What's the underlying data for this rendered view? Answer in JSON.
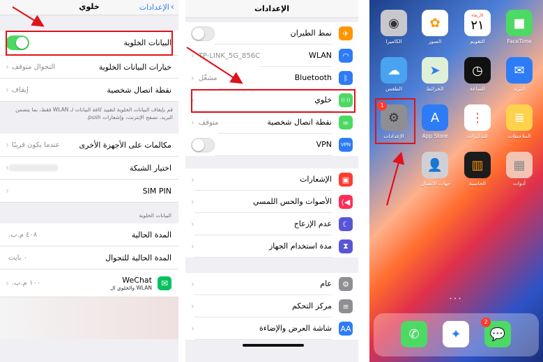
{
  "cellular": {
    "title": "خلوي",
    "back_label": "الإعدادات",
    "cellular_data": {
      "label": "البيانات الخلوية",
      "on": true
    },
    "data_options": {
      "label": "خيارات البيانات الخلوية",
      "value": "التجوال متوقف"
    },
    "hotspot": {
      "label": "نقطة اتصال شخصية",
      "value": "إيقاف"
    },
    "note": "قم بإيقاف البيانات الخلوية لتقييد كافة البيانات لـ WLAN فقط، بما يتضمن البريد، تصفح الإنترنت، وإشعارات push.",
    "other_devices": {
      "label": "مكالمات على الأجهزة الأخرى",
      "value": "عندما يكون قريبًا"
    },
    "network_selection": {
      "label": "اختيار الشبكة"
    },
    "sim_pin": {
      "label": "SIM PIN"
    },
    "section_header": "البيانات الخلوية",
    "current_period": {
      "label": "المدة الحالية",
      "value": "٤٠٨ م.ب."
    },
    "current_roaming": {
      "label": "المدة الحالية للتجوال",
      "value": "٠ بايت"
    },
    "wechat": {
      "label": "WeChat",
      "sublabel": "WLAN والخلوي ال",
      "value": "١٠٠ م.ب."
    }
  },
  "settings": {
    "title": "الإعدادات",
    "rows": [
      {
        "label": "نمط الطيران",
        "icon": "airplane-icon",
        "color": "#ff9500",
        "glyph": "✈",
        "toggle": true
      },
      {
        "label": "WLAN",
        "icon": "wifi-icon",
        "color": "#2d7cf6",
        "glyph": "◠",
        "value": "TP-LINK_5G_856C"
      },
      {
        "label": "Bluetooth",
        "icon": "bluetooth-icon",
        "color": "#2d7cf6",
        "glyph": "ᛒ",
        "value": "مشغّل"
      },
      {
        "label": "خلوي",
        "icon": "cellular-icon",
        "color": "#4cd964",
        "glyph": "((·))"
      },
      {
        "label": "نقطة اتصال شخصية",
        "icon": "hotspot-icon",
        "color": "#4cd964",
        "glyph": "∞",
        "value": "متوقف"
      },
      {
        "label": "VPN",
        "icon": "vpn-icon",
        "color": "#2d7cf6",
        "glyph": "VPN",
        "toggle": true
      }
    ],
    "rows2": [
      {
        "label": "الإشعارات",
        "icon": "notifications-icon",
        "color": "#ff3b30",
        "glyph": "▣"
      },
      {
        "label": "الأصوات والحس اللمسي",
        "icon": "sounds-icon",
        "color": "#ff2d55",
        "glyph": "◀)"
      },
      {
        "label": "عدم الإزعاج",
        "icon": "moon-icon",
        "color": "#5856d6",
        "glyph": "☾"
      },
      {
        "label": "مدة استخدام الجهاز",
        "icon": "hourglass-icon",
        "color": "#5856d6",
        "glyph": "⧗"
      }
    ],
    "rows3": [
      {
        "label": "عام",
        "icon": "gear-icon",
        "color": "#8e8e93",
        "glyph": "⚙"
      },
      {
        "label": "مركز التحكم",
        "icon": "control-center-icon",
        "color": "#8e8e93",
        "glyph": "≡"
      },
      {
        "label": "شاشة العرض والإضاءة",
        "icon": "display-icon",
        "color": "#2d7cf6",
        "glyph": "AA"
      }
    ]
  },
  "home": {
    "apps": [
      {
        "name": "FaceTime",
        "icon": "facetime-icon",
        "bg": "#4cd964",
        "glyph": "■",
        "fg": "#fff"
      },
      {
        "name": "التقويم",
        "icon": "calendar-icon",
        "bg": "#ffffff",
        "glyph": "٢١",
        "fg": "#000",
        "top": "الأربعاء"
      },
      {
        "name": "الصور",
        "icon": "photos-icon",
        "bg": "#ffffff",
        "glyph": "✿",
        "fg": "#ff9500"
      },
      {
        "name": "الكاميرا",
        "icon": "camera-icon",
        "bg": "#c7c7cc",
        "glyph": "◉",
        "fg": "#333"
      },
      {
        "name": "البريد",
        "icon": "mail-icon",
        "bg": "#2d7cf6",
        "glyph": "✉",
        "fg": "#fff"
      },
      {
        "name": "الساعة",
        "icon": "clock-icon",
        "bg": "#111111",
        "glyph": "◷",
        "fg": "#fff"
      },
      {
        "name": "الخرائط",
        "icon": "maps-icon",
        "bg": "#dff0d8",
        "glyph": "➤",
        "fg": "#2d7cf6"
      },
      {
        "name": "الطقس",
        "icon": "weather-icon",
        "bg": "#4aa3f0",
        "glyph": "☁",
        "fg": "#fff"
      },
      {
        "name": "الملاحظات",
        "icon": "notes-icon",
        "bg": "#ffd24d",
        "glyph": "≣",
        "fg": "#fff"
      },
      {
        "name": "التذكيرات",
        "icon": "reminders-icon",
        "bg": "#ffffff",
        "glyph": "⋮",
        "fg": "#ff3b30"
      },
      {
        "name": "App Store",
        "icon": "app-store-icon",
        "bg": "#2d7cf6",
        "glyph": "A",
        "fg": "#fff"
      },
      {
        "name": "الإعدادات",
        "icon": "settings-icon",
        "bg": "#8e8e93",
        "glyph": "⚙",
        "fg": "#333",
        "badge": "1"
      },
      {
        "name": "أدوات",
        "icon": "utilities-folder-icon",
        "bg": "#f3c4b4",
        "glyph": "▦",
        "fg": "#888"
      },
      {
        "name": "الحاسبة",
        "icon": "calculator-icon",
        "bg": "#1c1c1e",
        "glyph": "▥",
        "fg": "#ff9500"
      },
      {
        "name": "جهات الاتصال",
        "icon": "contacts-icon",
        "bg": "#d0d0d4",
        "glyph": "👤",
        "fg": "#777"
      }
    ],
    "dock": [
      {
        "icon": "messages-icon",
        "bg": "#4cd964",
        "glyph": "💬",
        "badge": "2"
      },
      {
        "icon": "safari-icon",
        "bg": "#ffffff",
        "glyph": "✦",
        "fg": "#2d7cf6"
      },
      {
        "icon": "phone-icon",
        "bg": "#4cd964",
        "glyph": "✆",
        "fg": "#fff"
      }
    ],
    "page_dots": "•••"
  },
  "colors": {
    "accent_red": "#e0121a",
    "ios_blue": "#2d7cf6",
    "ios_green": "#4cd964"
  }
}
